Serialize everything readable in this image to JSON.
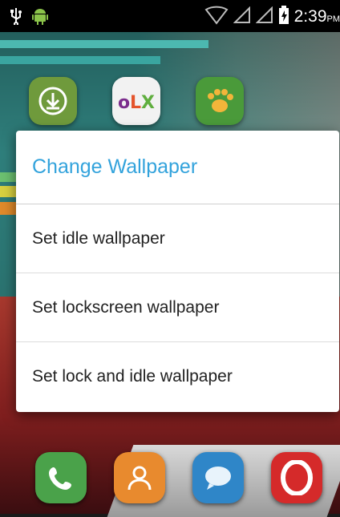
{
  "status_bar": {
    "time": "2:39",
    "period": "PM",
    "icons": [
      "usb-icon",
      "android-icon",
      "wifi-icon",
      "signal-icon",
      "signal-icon",
      "battery-charging-icon"
    ]
  },
  "home": {
    "apps": [
      {
        "name": "download-app-icon",
        "label": "Downloads",
        "color": "#6f9a3c"
      },
      {
        "name": "olx-app-icon",
        "label": "OLX",
        "color": "#f2f2f2"
      },
      {
        "name": "paw-app-icon",
        "label": "",
        "color": "#4a9a3a"
      }
    ],
    "dock": [
      {
        "name": "phone-icon",
        "color": "#4aa24a"
      },
      {
        "name": "contacts-icon",
        "color": "#e88a2e"
      },
      {
        "name": "messaging-icon",
        "color": "#2f86c8"
      },
      {
        "name": "opera-browser-icon",
        "color": "#d52a2a"
      }
    ]
  },
  "dialog": {
    "title": "Change Wallpaper",
    "options": [
      "Set idle wallpaper",
      "Set lockscreen wallpaper",
      "Set lock and idle wallpaper"
    ]
  },
  "colors": {
    "title_accent": "#33a3dc",
    "option_text": "#222222",
    "divider": "#dcdcdc"
  }
}
